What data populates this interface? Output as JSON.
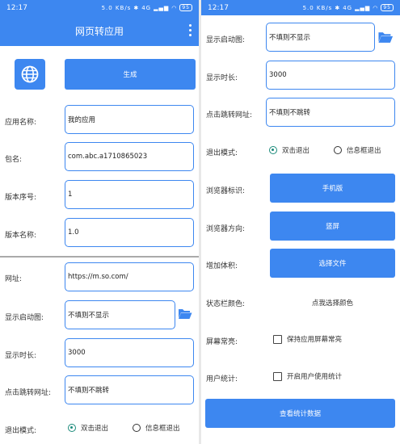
{
  "status_bar": {
    "time": "12:17",
    "signal_text": "5.0 KB/s",
    "network": "4G",
    "battery": "95"
  },
  "app_bar": {
    "title": "网页转应用"
  },
  "left": {
    "generate_label": "生成",
    "app_name": {
      "label": "应用名称:",
      "value": "我的应用"
    },
    "package": {
      "label": "包名:",
      "value": "com.abc.a1710865023"
    },
    "version_code": {
      "label": "版本序号:",
      "value": "1"
    },
    "version_name": {
      "label": "版本名称:",
      "value": "1.0"
    },
    "url": {
      "label": "网址:",
      "value": "https://m.so.com/"
    },
    "splash_image": {
      "label": "显示启动图:",
      "value": "不填则不显示"
    },
    "display_time": {
      "label": "显示时长:",
      "value": "3000"
    },
    "click_url": {
      "label": "点击跳转网址:",
      "value": "不填则不跳转"
    },
    "exit_mode": {
      "label": "退出模式:",
      "opt1": "双击退出",
      "opt2": "信息框退出"
    }
  },
  "right": {
    "splash_image": {
      "label": "显示启动图:",
      "value": "不填则不显示"
    },
    "display_time": {
      "label": "显示时长:",
      "value": "3000"
    },
    "click_url": {
      "label": "点击跳转网址:",
      "value": "不填则不跳转"
    },
    "exit_mode": {
      "label": "退出模式:",
      "opt1": "双击退出",
      "opt2": "信息框退出"
    },
    "browser_ua": {
      "label": "浏览器标识:",
      "button": "手机版"
    },
    "browser_orientation": {
      "label": "浏览器方向:",
      "button": "竖屏"
    },
    "add_volume": {
      "label": "增加体积:",
      "button": "选择文件"
    },
    "statusbar_color": {
      "label": "状态栏颜色:",
      "value": "点我选择颜色"
    },
    "screen_on": {
      "label": "屏幕常亮:",
      "checkbox": "保持应用屏幕常亮"
    },
    "user_stats": {
      "label": "用户统计:",
      "checkbox": "开启用户使用统计"
    },
    "view_stats_button": "查看统计数据"
  },
  "colors": {
    "accent": "#3d87f0",
    "radio_selected": "#1a8a7a"
  }
}
